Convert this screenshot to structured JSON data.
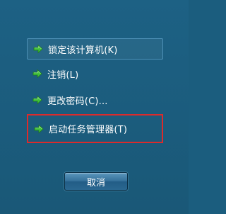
{
  "menu": {
    "items": [
      {
        "label": "锁定该计算机(K)",
        "icon": "green-arrow-icon",
        "state": "hovered"
      },
      {
        "label": "注销(L)",
        "icon": "green-arrow-icon",
        "state": "normal"
      },
      {
        "label": "更改密码(C)...",
        "icon": "green-arrow-icon",
        "state": "normal"
      },
      {
        "label": "启动任务管理器(T)",
        "icon": "green-arrow-icon",
        "state": "highlighted"
      }
    ]
  },
  "cancel_button": {
    "label": "取消"
  },
  "colors": {
    "background": "#1b5d7e",
    "highlight_border": "#dc2b2b",
    "hover_border": "#4d90b6",
    "arrow_green": "#3fbf3a"
  }
}
